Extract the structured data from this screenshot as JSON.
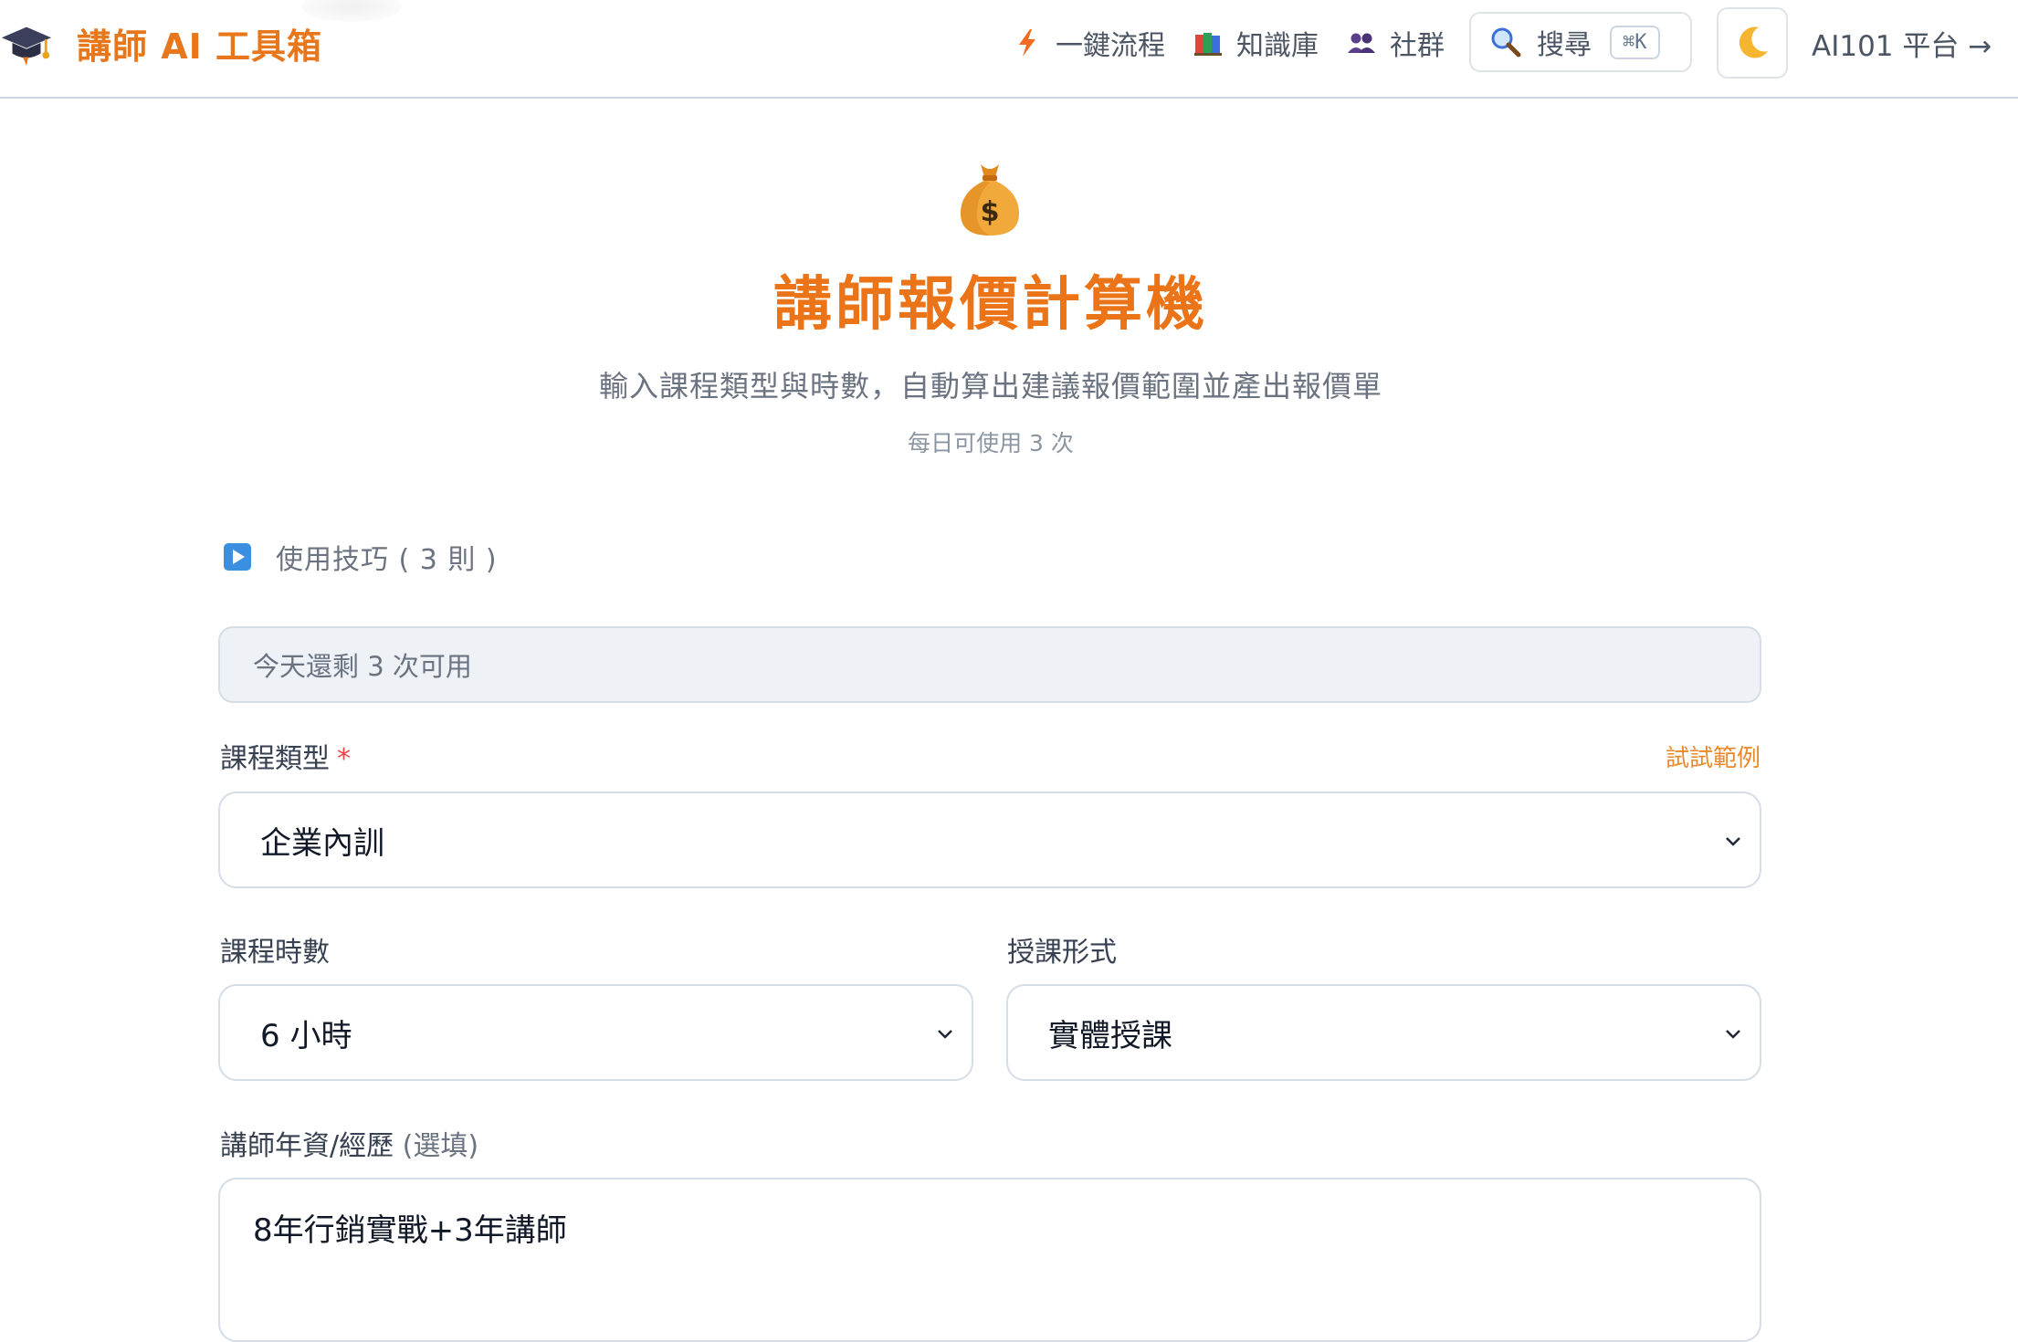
{
  "header": {
    "brand": "講師 AI 工具箱",
    "nav": [
      {
        "label": "一鍵流程",
        "icon": "lightning-icon"
      },
      {
        "label": "知識庫",
        "icon": "books-icon"
      },
      {
        "label": "社群",
        "icon": "people-icon"
      }
    ],
    "search_label": "搜尋",
    "search_shortcut": "⌘K",
    "theme_icon": "moon-icon",
    "platform_link": "AI101 平台 →"
  },
  "hero": {
    "icon": "money-bag-icon",
    "title": "講師報價計算機",
    "subtitle": "輸入課程類型與時數，自動算出建議報價範圍並產出報價單",
    "usage_note": "每日可使用 3 次"
  },
  "tips": {
    "label": "使用技巧 ( 3 則 )",
    "icon": "play-icon"
  },
  "quota_banner": "今天還剩 3 次可用",
  "form": {
    "course_type": {
      "label": "課程類型",
      "required_mark": "*",
      "try_example": "試試範例",
      "value": "企業內訓"
    },
    "hours": {
      "label": "課程時數",
      "value": "6 小時"
    },
    "format": {
      "label": "授課形式",
      "value": "實體授課"
    },
    "experience": {
      "label": "講師年資/經歷",
      "optional_mark": "(選填)",
      "value": "8年行銷實戰+3年講師"
    }
  },
  "colors": {
    "brand_orange": "#ea7417",
    "required_red": "#ef4444",
    "banner_bg": "#eef2f7"
  }
}
